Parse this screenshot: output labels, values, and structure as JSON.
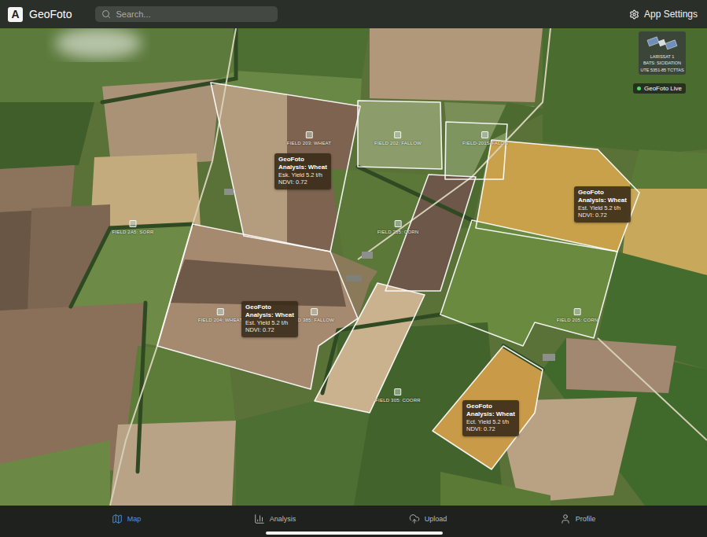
{
  "app": {
    "logo": "A",
    "title": "GeoFoto"
  },
  "search": {
    "placeholder": "Search..."
  },
  "settings": {
    "label": "App Settings"
  },
  "satellite": {
    "lines": [
      "LARISSAT 1",
      "BATS: SICIDATION",
      "UTE 5351-85 TCTTAS"
    ],
    "status": "GeoFoto Live",
    "live": true
  },
  "map": {
    "field_labels": [
      "FIELD 203: WHEAT",
      "FIELD 202: FALLOW",
      "FIELD-201S-FALON",
      "FIELD 2A5: SORR",
      "FIELD 255: CORN",
      "FIELD 204: WHEAT",
      "LD 385: FALLOW",
      "FIELD 205: CORN",
      "FIELD 305: COORR"
    ],
    "analysis_cards": [
      {
        "brand": "GeoFoto",
        "title": "Analysis: Wheat",
        "yield": "Esk. Yield 5.2 t/h",
        "ndvi": "NDVI: 0.72"
      },
      {
        "brand": "GeoFoto",
        "title": "Analysis: Wheat",
        "yield": "Est. Yield 5.2 t/h",
        "ndvi": "NDVI: 0.72"
      },
      {
        "brand": "GeoFoto",
        "title": "Analysis: Wheat",
        "yield": "Est. Yield 5.2 t/h",
        "ndvi": "NDVI: 0.72"
      },
      {
        "brand": "GeoFoto",
        "title": "Analysis: Wheat",
        "yield": "Ect. Yield 5.2 t/h",
        "ndvi": "NDVI: 0.72"
      }
    ]
  },
  "nav": {
    "tabs": [
      {
        "label": "Map",
        "selected": true
      },
      {
        "label": "Analysis",
        "selected": false
      },
      {
        "label": "Upload",
        "selected": false
      },
      {
        "label": "Profile",
        "selected": false
      }
    ]
  }
}
